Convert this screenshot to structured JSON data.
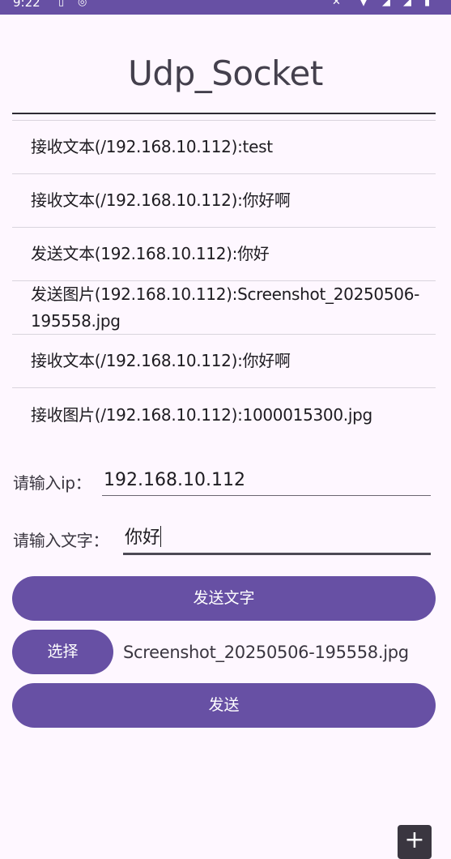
{
  "status_bar": {
    "time": "9:22",
    "icons": [
      "sim-icon",
      "sync-icon",
      "mute-icon",
      "wifi-icon",
      "signal-icon",
      "signal-icon",
      "battery-icon"
    ]
  },
  "app": {
    "title": "Udp_Socket",
    "accent_color": "#6750A4",
    "background_color": "#FEF7FF"
  },
  "messages": [
    "接收文本(/192.168.10.112):test",
    "接收文本(/192.168.10.112):你好啊",
    "发送文本(192.168.10.112):你好",
    "发送图片(192.168.10.112):Screenshot_20250506-195558.jpg",
    "接收文本(/192.168.10.112):你好啊",
    "接收图片(/192.168.10.112):1000015300.jpg"
  ],
  "form": {
    "ip_label": "请输入ip：",
    "ip_value": "192.168.10.112",
    "text_label": "请输入文字：",
    "text_value": "你好"
  },
  "buttons": {
    "send_text": "发送文字",
    "choose": "选择",
    "send": "发送"
  },
  "selected_file": "Screenshot_20250506-195558.jpg",
  "fab_icon": "plus-icon"
}
